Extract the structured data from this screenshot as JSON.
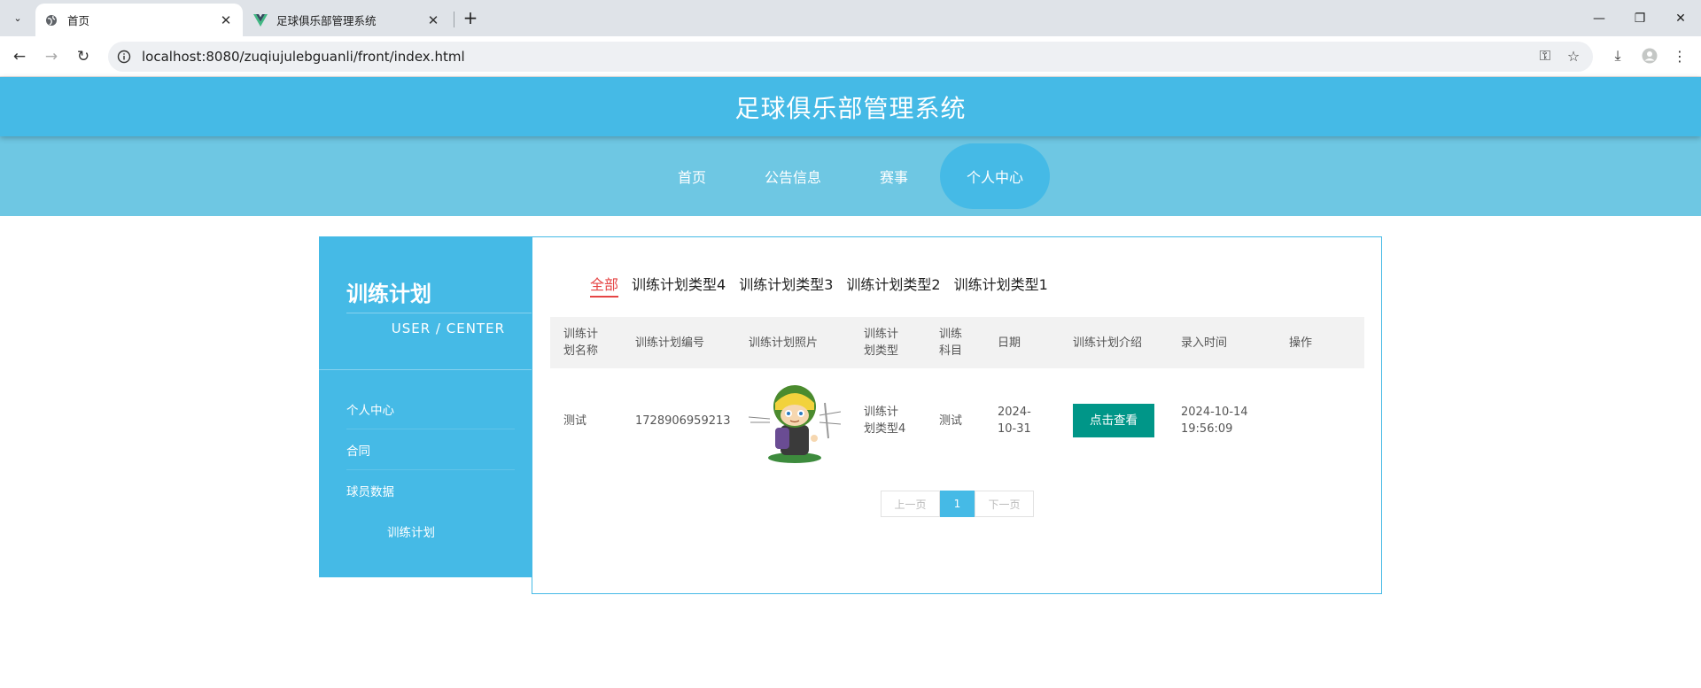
{
  "browser": {
    "tabs": [
      {
        "title": "首页",
        "active": true
      },
      {
        "title": "足球俱乐部管理系统",
        "active": false
      }
    ],
    "url": "localhost:8080/zuqiujulebguanli/front/index.html"
  },
  "site": {
    "title": "足球俱乐部管理系统",
    "nav": [
      {
        "label": "首页",
        "active": false
      },
      {
        "label": "公告信息",
        "active": false
      },
      {
        "label": "赛事",
        "active": false
      },
      {
        "label": "个人中心",
        "active": true
      }
    ]
  },
  "sidebar": {
    "title": "训练计划",
    "subtitle": "USER / CENTER",
    "items": [
      {
        "label": "个人中心"
      },
      {
        "label": "合同"
      },
      {
        "label": "球员数据"
      },
      {
        "label": "训练计划"
      }
    ]
  },
  "content": {
    "categories": [
      "全部",
      "训练计划类型4",
      "训练计划类型3",
      "训练计划类型2",
      "训练计划类型1"
    ],
    "active_category": "全部",
    "columns": [
      "训练计划名称",
      "训练计划编号",
      "训练计划照片",
      "训练计划类型",
      "训练科目",
      "日期",
      "训练计划介绍",
      "录入时间",
      "操作"
    ],
    "rows": [
      {
        "name": "测试",
        "number": "1728906959213",
        "type": "训练计划类型4",
        "subject": "测试",
        "date": "2024-10-31",
        "intro_button": "点击查看",
        "created": "2024-10-14 19:56:09"
      }
    ],
    "pager": {
      "prev": "上一页",
      "current": "1",
      "next": "下一页"
    }
  },
  "colors": {
    "primary": "#45bae6",
    "nav_bg": "#6ec7e3",
    "button": "#009688",
    "active_category": "#e54545"
  }
}
